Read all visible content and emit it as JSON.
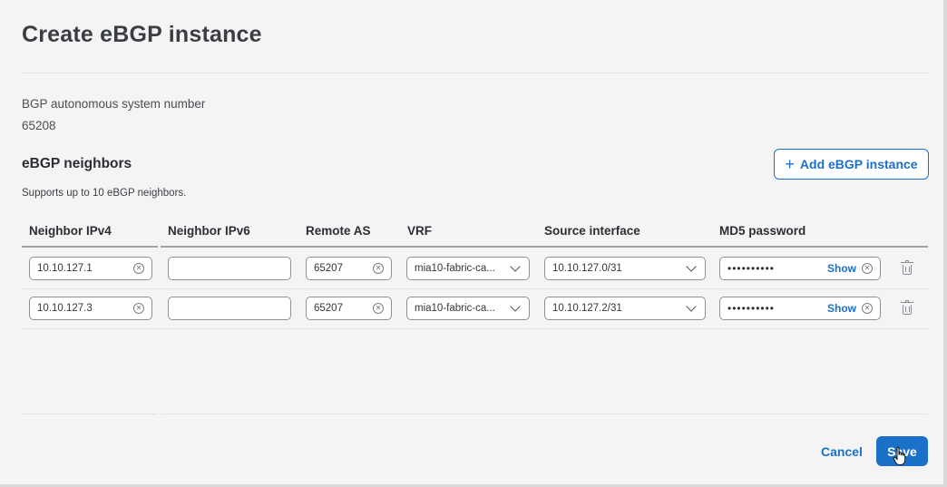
{
  "dialog": {
    "title": "Create eBGP instance"
  },
  "asn": {
    "label": "BGP autonomous system number",
    "value": "65208"
  },
  "neighbors": {
    "title": "eBGP neighbors",
    "note": "Supports up to 10 eBGP neighbors.",
    "add_button_label": "Add eBGP instance",
    "columns": [
      "Neighbor IPv4",
      "Neighbor IPv6",
      "Remote AS",
      "VRF",
      "Source interface",
      "MD5 password"
    ],
    "rows": [
      {
        "ipv4": "10.10.127.1",
        "ipv6": "",
        "remote_as": "65207",
        "vrf": "mia10-fabric-ca...",
        "source_interface": "10.10.127.0/31",
        "password_mask": "••••••••••",
        "show_label": "Show"
      },
      {
        "ipv4": "10.10.127.3",
        "ipv6": "",
        "remote_as": "65207",
        "vrf": "mia10-fabric-ca...",
        "source_interface": "10.10.127.2/31",
        "password_mask": "••••••••••",
        "show_label": "Show"
      }
    ]
  },
  "footer": {
    "cancel_label": "Cancel",
    "save_label": "Save"
  },
  "icons": {
    "add": "plus-icon",
    "clear": "clear-circle-icon",
    "dropdown": "chevron-down-icon",
    "delete": "trash-icon",
    "cursor": "hand-pointer-icon"
  },
  "colors": {
    "accent": "#1b70c7",
    "background": "#f4f4f4"
  }
}
